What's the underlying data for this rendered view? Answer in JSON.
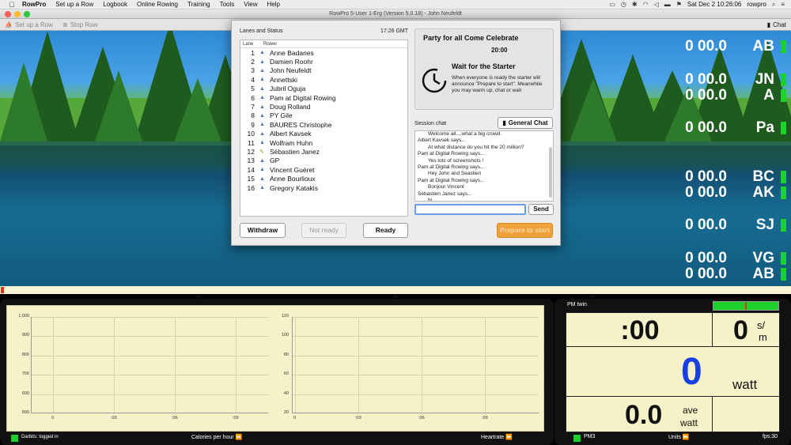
{
  "menubar": {
    "app": "RowPro",
    "items": [
      "Set up a Row",
      "Logbook",
      "Online Rowing",
      "Training",
      "Tools",
      "View",
      "Help"
    ],
    "clock": "Sat Dec 2  10:26:06",
    "user": "rowpro"
  },
  "window": {
    "title": "RowPro 5-User 1-Erg (Version 5.0.18) - John Neufeldt"
  },
  "toolbar": {
    "setup": "Set up a Row",
    "stop": "Stop Row",
    "chat": "Chat"
  },
  "scene": {
    "rowers": [
      {
        "dist": "0 00.0",
        "initials": "AB"
      },
      {
        "dist": "0 00.0",
        "initials": "JN"
      },
      {
        "dist": "0 00.0",
        "initials": "A"
      },
      {
        "dist": "0 00.0",
        "initials": "Pa"
      },
      {
        "dist": "0 00.0",
        "initials": "BC"
      },
      {
        "dist": "0 00.0",
        "initials": "AK"
      },
      {
        "dist": "0 00.0",
        "initials": "SJ"
      },
      {
        "dist": "0 00.0",
        "initials": "VG"
      },
      {
        "dist": "0 00.0",
        "initials": "AB"
      }
    ]
  },
  "modal": {
    "lanes_title": "Lanes and Status",
    "time": "17:26 GMT",
    "col_lane": "Lane",
    "col_rower": "Rower",
    "lanes": [
      {
        "n": "1",
        "name": "Anne Badanes"
      },
      {
        "n": "2",
        "name": "Damien Roohr"
      },
      {
        "n": "3",
        "name": "John Neufeldt"
      },
      {
        "n": "4",
        "name": "Annettski"
      },
      {
        "n": "5",
        "name": "Jubril Oguja"
      },
      {
        "n": "6",
        "name": "Pam at Digital Rowing"
      },
      {
        "n": "7",
        "name": "Doug Rolland"
      },
      {
        "n": "8",
        "name": "PY Gile"
      },
      {
        "n": "9",
        "name": "BAURES Christophe"
      },
      {
        "n": "10",
        "name": "Albert Kavsek"
      },
      {
        "n": "11",
        "name": "Wolfram Huhn"
      },
      {
        "n": "12",
        "name": "Sébastien Janez"
      },
      {
        "n": "13",
        "name": "GP"
      },
      {
        "n": "14",
        "name": "Vincent Guéret"
      },
      {
        "n": "15",
        "name": "Anne Bourlioux"
      },
      {
        "n": "16",
        "name": "Gregory Katakis"
      }
    ],
    "party_title": "Party for all Come Celebrate",
    "party_time": "20:00",
    "wait_title": "Wait for the Starter",
    "wait_text": "When everyone is ready the starter will announce \"Prepare to start\". Meanwhile you may warm up, chat or wait",
    "session_label": "Session chat",
    "general_chat": "General Chat",
    "chat": [
      {
        "t": "Welcome all....what a big crowd.",
        "msg": true
      },
      {
        "t": "Albert Kavsek says...",
        "msg": false
      },
      {
        "t": "At what distance do you hit the 20 million?",
        "msg": true
      },
      {
        "t": "Pam at Digital Rowing says...",
        "msg": false
      },
      {
        "t": "Yes lots of screenshots !",
        "msg": true
      },
      {
        "t": "Pam at Digital Rowing says...",
        "msg": false
      },
      {
        "t": "Hey John and Seastien",
        "msg": true
      },
      {
        "t": "Pam at Digital Rowing says...",
        "msg": false
      },
      {
        "t": "Bonjour Vincent",
        "msg": true
      },
      {
        "t": "Sébastien Janez says...",
        "msg": false
      },
      {
        "t": "hi",
        "msg": true
      }
    ],
    "send": "Send",
    "withdraw": "Withdraw",
    "not_ready": "Not ready",
    "ready": "Ready",
    "prepare": "Prepare to start"
  },
  "graphs": {
    "left_y": [
      "1,000",
      "900",
      "800",
      "700",
      "600",
      "500"
    ],
    "right_y": [
      "120",
      "100",
      "80",
      "60",
      "40",
      "20"
    ],
    "x": [
      "0",
      ":03",
      ":06",
      ":09"
    ],
    "status": "Darbits: logged in",
    "left_label": "Calories per hour",
    "right_label": "Heartrate"
  },
  "pm": {
    "title": "PM twin",
    "time": ":00",
    "spm": "0",
    "spm_unit_top": "s/",
    "spm_unit_bottom": "m",
    "watts": "0",
    "watts_unit": "watt",
    "ave": "0.0",
    "ave_unit_top": "ave",
    "ave_unit_bottom": "watt",
    "monitor": "PM3",
    "units": "Units",
    "fps": "fps:30"
  },
  "colors": {
    "accent_green": "#1bd12a",
    "prepare_orange": "#f0a23a",
    "watt_blue": "#1a3fe0"
  }
}
